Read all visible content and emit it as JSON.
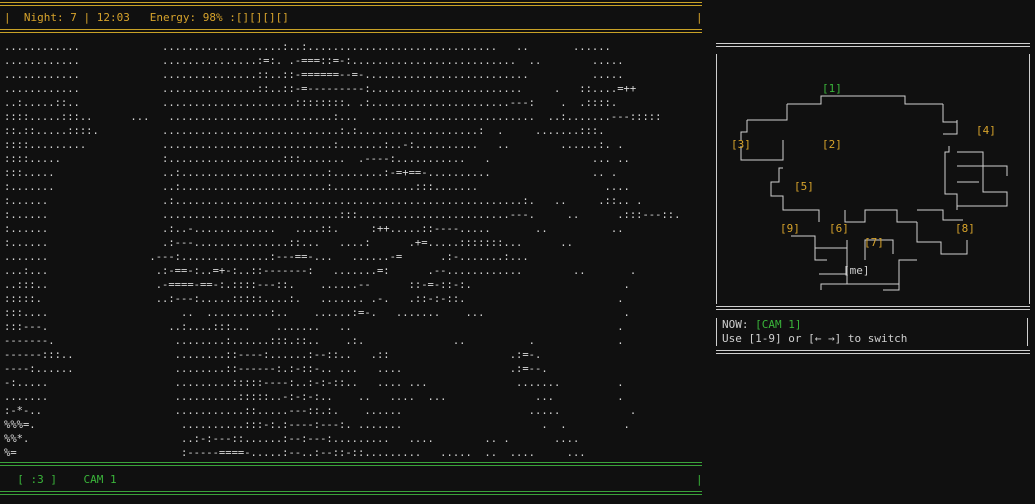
{
  "hud": {
    "night_label": "Night:",
    "night": "7",
    "clock": "12:03",
    "energy_label": "Energy:",
    "energy": "98%",
    "energy_bars": ":[][][][]"
  },
  "camera_view": {
    "ascii": "............             ...................:..:..............................   ..       ......\n............             ...............:=:. .-===::=-:..........................  ..        .....\n............             ...............::..::-======--=-..........................          .....\n............             ...............::..::-=---------:........................     .   ::....=++\n..:.....::..             .....................::::::::. .:......................---:    .  .::::.\n::::.....:::..      ...   ..........................:...  ..........................  ..:.......---:::::\n::.::.....::::.          ............................:.:...................:  .     .......:::.\n::::.........            ...........................:.......:..-:..........   ..        ......:. .\n::::.....                :..................:::.......  .----:...........   .                ... ..\n:::.....                 ..:.......................:........:-=+==-..........                .. .\n:.......                 ..:.......................:.............:::.......                    ....\n:......                  .:.......................................................:.   ..     .::.. .\n:......                  ............................:::........................---.     ..      .:::---::.\n:......                  .:..-.............   ....::.     :++.....::----.....       ..          ..\n:......                  .:---...............::...   ....:      .+=.....:::::::...      ..\n.......                .---:..............:---==-...   ......-=      .:-.......:...\n...:...                 .:-==-:..=+-:..::-------:   .......=:      .--............        ..       .\n..:::..                 .-====-==-:.::::---::.    ......--      ::-=-::-:.                        .\n:::::.                  ..:---:.....:::::....:.   ....... .-.   .::-:-::.                        .\n:::....                     ..  ..........:..    ......:=-.   .......    ...                      .\n:::---.                   ..:....:::...    .......   ..                                          .\n-------.                   ........:......:::.::..    .:.              ..          .             .\n------:::..                ........::----:......:--::..   .::                   .:=-.\n----:......                ........::------:.:-::-.. ...   ....                 .:=--.\n-:.....                    .........:::::----:..:-:-::..   .... ...              .......         .\n.......                    ..........:::::..-:-:-:..    ..   ....  ...              ...          .\n:-*-..                     ...........::.....---::.:.    ......                    .....           .\n%%%=.                       ..........:::-:.:----:---:. .......                      .  .         .\n%%*.                        ..:-:---::......:--:---:.........   ....        .. .       ....\n%=                          :-----====-.....:--..:--::-::.........   .....  ..  ....     ..."
  },
  "footer": {
    "face": "[ :3 ]",
    "cam": "CAM 1"
  },
  "map": {
    "cameras": [
      {
        "label": "[1]",
        "state": "active"
      },
      {
        "label": "[2]",
        "state": "idle"
      },
      {
        "label": "[3]",
        "state": "idle"
      },
      {
        "label": "[4]",
        "state": "idle"
      },
      {
        "label": "[5]",
        "state": "idle"
      },
      {
        "label": "[6]",
        "state": "idle"
      },
      {
        "label": "[7]",
        "state": "idle"
      },
      {
        "label": "[8]",
        "state": "idle"
      },
      {
        "label": "[9]",
        "state": "idle"
      },
      {
        "label": "[me]",
        "state": "me"
      }
    ]
  },
  "status": {
    "now_label": "NOW:",
    "now_cam": "[CAM 1]",
    "hint": "Use [1-9] or [← →] to switch"
  },
  "colors": {
    "accent_yellow": "#d7a32b",
    "accent_green": "#3ab53a",
    "background": "#101010",
    "text": "#cfcfcf"
  }
}
